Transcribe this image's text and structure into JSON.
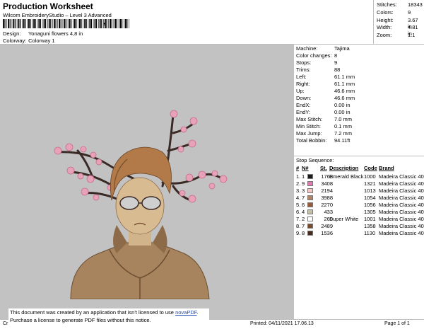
{
  "header": {
    "title": "Production Worksheet",
    "subtitle": "Wilcom EmbroideryStudio – Level 3 Advanced",
    "barcode_tail": ",",
    "design_label": "Design:",
    "design_value": "Yonaguni flowers 4,8 in",
    "colorway_label": "Colorway:",
    "colorway_value": "Colorway 1"
  },
  "stats": [
    {
      "label": "Stitches:",
      "value": "18343"
    },
    {
      "label": "Colors:",
      "value": "9"
    },
    {
      "label": "Height:",
      "value": "3.67 in"
    },
    {
      "label": "Width:",
      "value": "4.81 in"
    },
    {
      "label": "Zoom:",
      "value": "1:1"
    }
  ],
  "machine_info": [
    {
      "label": "Machine:",
      "value": "Tajima"
    },
    {
      "label": "Color changes:",
      "value": "8"
    },
    {
      "label": "Stops:",
      "value": "9"
    },
    {
      "label": "Trims:",
      "value": "88"
    },
    {
      "label": "Left:",
      "value": "61.1 mm"
    },
    {
      "label": "Right:",
      "value": "61.1 mm"
    },
    {
      "label": "Up:",
      "value": "46.6 mm"
    },
    {
      "label": "Down:",
      "value": "46.6 mm"
    },
    {
      "label": "EndX:",
      "value": "0.00 in"
    },
    {
      "label": "EndY:",
      "value": "0.00 in"
    },
    {
      "label": "Max Stitch:",
      "value": "7.0 mm"
    },
    {
      "label": "Min Stitch:",
      "value": "0.1 mm"
    },
    {
      "label": "Max Jump:",
      "value": "7.2 mm"
    },
    {
      "label": "Total Bobbin:",
      "value": "94.11ft"
    }
  ],
  "stop_sequence": {
    "title": "Stop Sequence:",
    "headers": {
      "num": "#",
      "n": "N#",
      "st": "St.",
      "desc": "Description",
      "code": "Code",
      "brand": "Brand"
    },
    "rows": [
      {
        "num": "1.",
        "n": "1",
        "color": "#1a1a1a",
        "st": "1763",
        "desc": "Emerald Black",
        "code": "1000",
        "brand": "Madeira Classic 40"
      },
      {
        "num": "2.",
        "n": "9",
        "color": "#e07ab0",
        "st": "3408",
        "desc": "",
        "code": "1321",
        "brand": "Madeira Classic 40"
      },
      {
        "num": "3.",
        "n": "3",
        "color": "#f2c7c2",
        "st": "2194",
        "desc": "",
        "code": "1013",
        "brand": "Madeira Classic 40"
      },
      {
        "num": "4.",
        "n": "7",
        "color": "#b08466",
        "st": "3988",
        "desc": "",
        "code": "1054",
        "brand": "Madeira Classic 40"
      },
      {
        "num": "5.",
        "n": "6",
        "color": "#9a5a36",
        "st": "2270",
        "desc": "",
        "code": "1056",
        "brand": "Madeira Classic 40"
      },
      {
        "num": "6.",
        "n": "4",
        "color": "#c4bfa8",
        "st": "433",
        "desc": "",
        "code": "1305",
        "brand": "Madeira Classic 40"
      },
      {
        "num": "7.",
        "n": "2",
        "color": "#ffffff",
        "st": "260",
        "desc": "Super White",
        "code": "1001",
        "brand": "Madeira Classic 40"
      },
      {
        "num": "8.",
        "n": "7",
        "color": "#7a4a2c",
        "st": "2489",
        "desc": "",
        "code": "1358",
        "brand": "Madeira Classic 40"
      },
      {
        "num": "9.",
        "n": "8",
        "color": "#4a2a1c",
        "st": "1536",
        "desc": "",
        "code": "1130",
        "brand": "Madeira Classic 40"
      }
    ]
  },
  "footer": {
    "left": "Cr",
    "printed": "Printed: 04/11/2021 17.06.13",
    "page": "Page 1 of 1"
  },
  "notice": {
    "line1_prefix": "This document was created by an application that isn't licensed to use ",
    "line1_link": "novaPDF",
    "line1_suffix": ".",
    "line2": "Purchase a license to generate PDF files without this notice."
  }
}
